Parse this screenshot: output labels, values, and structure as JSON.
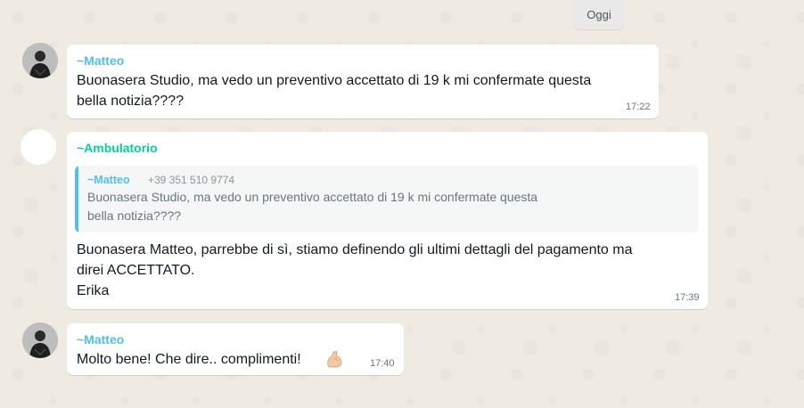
{
  "date_chip": "Oggi",
  "messages": [
    {
      "sender": "~Matteo",
      "sender_color": "#53bdeb",
      "text": "Buonasera Studio,  ma vedo un preventivo accettato di 19 k mi confermate questa\nbella notizia????",
      "time": "17:22"
    },
    {
      "sender": "~Ambulatorio",
      "sender_color": "#06cf9c",
      "quote": {
        "sender": "~Matteo",
        "phone": "+39 351 510 9774",
        "text": "Buonasera Studio,  ma vedo un preventivo accettato di 19 k mi confermate questa\nbella notizia????"
      },
      "text": "Buonasera Matteo, parrebbe di sì, stiamo definendo gli ultimi dettagli del pagamento ma\ndirei ACCETTATO.\nErika",
      "time": "17:39"
    },
    {
      "sender": "~Matteo",
      "sender_color": "#53bdeb",
      "text": "Molto bene! Che dire.. complimenti!",
      "emoji": "flexed-biceps-icon",
      "time": "17:40"
    }
  ]
}
